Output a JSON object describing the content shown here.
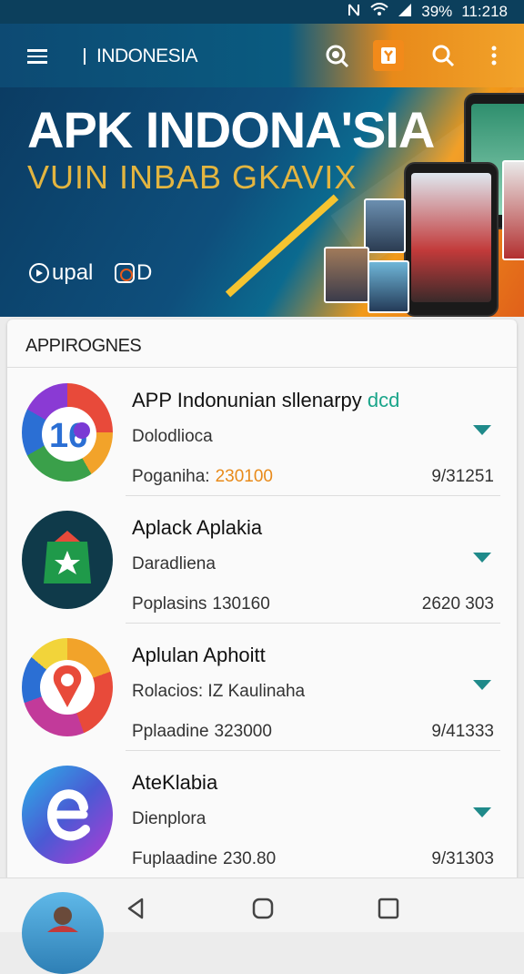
{
  "status": {
    "signal_icon": "signal-icon",
    "wifi_icon": "wifi-icon",
    "battery": "39%",
    "time": "11:218"
  },
  "appbar": {
    "title": "INDONESIA"
  },
  "banner": {
    "title": "APK INDONA'SIA",
    "subtitle": "VUIN ΙΝΒΑΒ GKAVIX",
    "logo1": "upal",
    "logo2": "D"
  },
  "section": {
    "title": "APPIROGNES"
  },
  "apps": [
    {
      "name": "APP Indonunian sllenarpy",
      "name_accent": "dcd",
      "subtitle": "Dolodlioca",
      "meta_label": "Poganiha:",
      "meta_value": "230100",
      "right_value": "9/31251"
    },
    {
      "name": "Aplack Aplakia",
      "name_accent": "",
      "subtitle": "Daradliena",
      "meta_label": "Poplasins",
      "meta_value": "130160",
      "right_value": "2620 303"
    },
    {
      "name": "Aplulan Aphoitt",
      "name_accent": "",
      "subtitle": "Rolacios: IZ Kaulinaha",
      "meta_label": "Pplaadine",
      "meta_value": "323000",
      "right_value": "9/41333"
    },
    {
      "name": "AteKlabia",
      "name_accent": "",
      "subtitle": "Dienplora",
      "meta_label": "Fuplaadine",
      "meta_value": "230.80",
      "right_value": "9/31303"
    }
  ],
  "colors": {
    "accent_teal": "#1f8a8a",
    "accent_orange": "#e88a1a",
    "header_blue": "#0d4a73"
  }
}
